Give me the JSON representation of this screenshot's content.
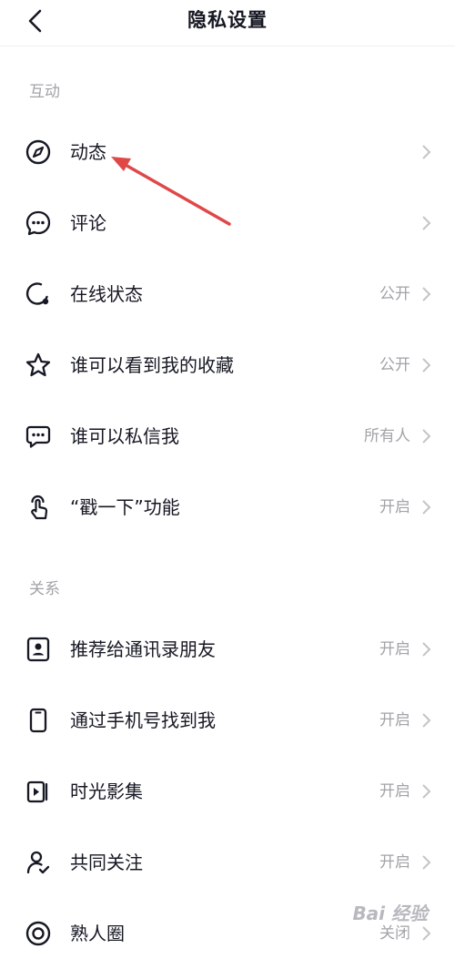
{
  "header": {
    "title": "隐私设置"
  },
  "sections": [
    {
      "title": "互动"
    },
    {
      "title": "关系"
    }
  ],
  "items": [
    {
      "label": "动态",
      "value": ""
    },
    {
      "label": "评论",
      "value": ""
    },
    {
      "label": "在线状态",
      "value": "公开"
    },
    {
      "label": "谁可以看到我的收藏",
      "value": "公开"
    },
    {
      "label": "谁可以私信我",
      "value": "所有人"
    },
    {
      "label": "“戳一下”功能",
      "value": "开启"
    },
    {
      "label": "推荐给通讯录朋友",
      "value": "开启"
    },
    {
      "label": "通过手机号找到我",
      "value": "开启"
    },
    {
      "label": "时光影集",
      "value": "开启"
    },
    {
      "label": "共同关注",
      "value": "开启"
    },
    {
      "label": "熟人圈",
      "value": "关闭"
    }
  ],
  "icons": [
    "compass-icon",
    "comment-bubble-icon",
    "online-status-icon",
    "star-icon",
    "message-icon",
    "tap-hand-icon",
    "contact-card-icon",
    "phone-icon",
    "photo-album-icon",
    "person-check-icon",
    "circle-target-icon"
  ],
  "watermark": {
    "text": "Bai 经验"
  },
  "colors": {
    "annotation_arrow": "#e04848",
    "secondary_text": "#a3a3a8"
  }
}
